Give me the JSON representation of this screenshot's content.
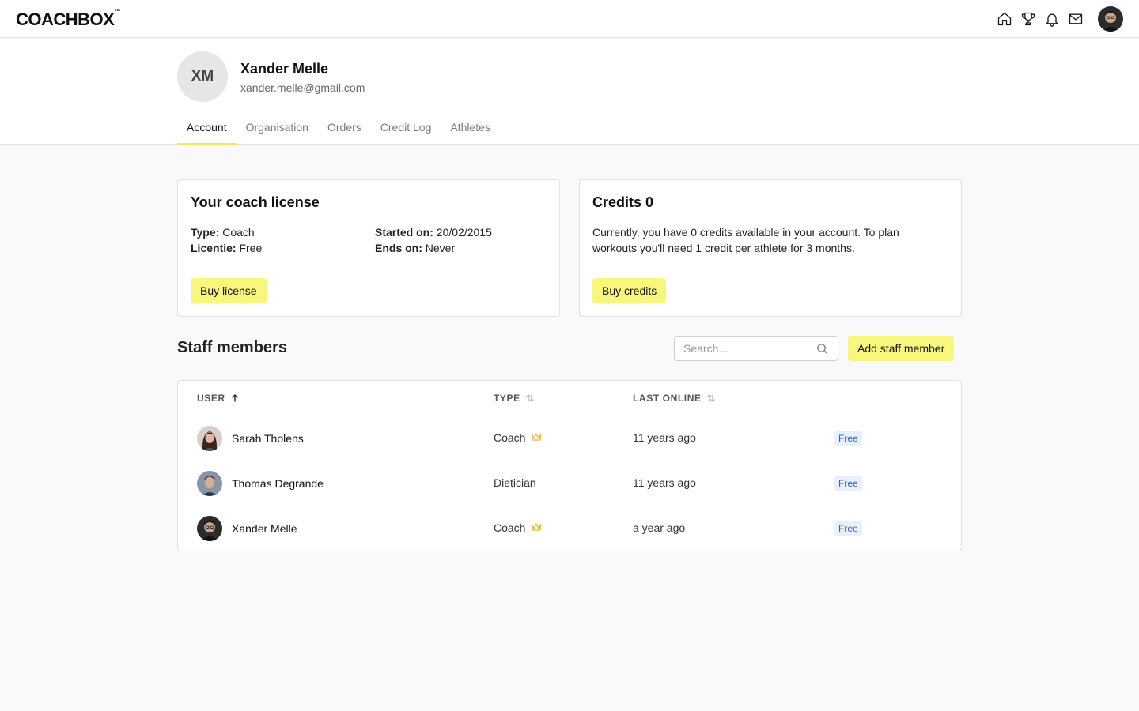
{
  "app": {
    "logo": "COACHBOX",
    "logo_mark": "™"
  },
  "nav": {
    "icons": [
      "home-icon",
      "trophy-icon",
      "bell-icon",
      "mail-icon"
    ]
  },
  "profile": {
    "initials": "XM",
    "name": "Xander Melle",
    "email": "xander.melle@gmail.com",
    "tabs": [
      {
        "label": "Account",
        "active": true
      },
      {
        "label": "Organisation",
        "active": false
      },
      {
        "label": "Orders",
        "active": false
      },
      {
        "label": "Credit Log",
        "active": false
      },
      {
        "label": "Athletes",
        "active": false
      }
    ]
  },
  "license": {
    "title": "Your coach license",
    "type_label": "Type:",
    "type_value": "Coach",
    "licentie_label": "Licentie:",
    "licentie_value": "Free",
    "started_label": "Started on:",
    "started_value": "20/02/2015",
    "ends_label": "Ends on:",
    "ends_value": "Never",
    "button": "Buy license"
  },
  "credits": {
    "title": "Credits 0",
    "text": "Currently, you have 0 credits available in your account. To plan workouts you'll need 1 credit per athlete for 3 months.",
    "button": "Buy credits"
  },
  "staff": {
    "title": "Staff members",
    "search_placeholder": "Search...",
    "add_button": "Add staff member",
    "columns": {
      "user": "USER",
      "type": "TYPE",
      "last_online": "LAST ONLINE"
    },
    "rows": [
      {
        "name": "Sarah Tholens",
        "type": "Coach",
        "crown": true,
        "last_online": "11 years ago",
        "badge": "Free"
      },
      {
        "name": "Thomas Degrande",
        "type": "Dietician",
        "crown": false,
        "last_online": "11 years ago",
        "badge": "Free"
      },
      {
        "name": "Xander Melle",
        "type": "Coach",
        "crown": true,
        "last_online": "a year ago",
        "badge": "Free"
      }
    ]
  },
  "colors": {
    "accent_yellow": "#f7f77e",
    "tab_underline": "#f3e65a",
    "badge_bg": "#e8f0fd",
    "badge_text": "#2f5fc4",
    "crown": "#e3b92a"
  }
}
